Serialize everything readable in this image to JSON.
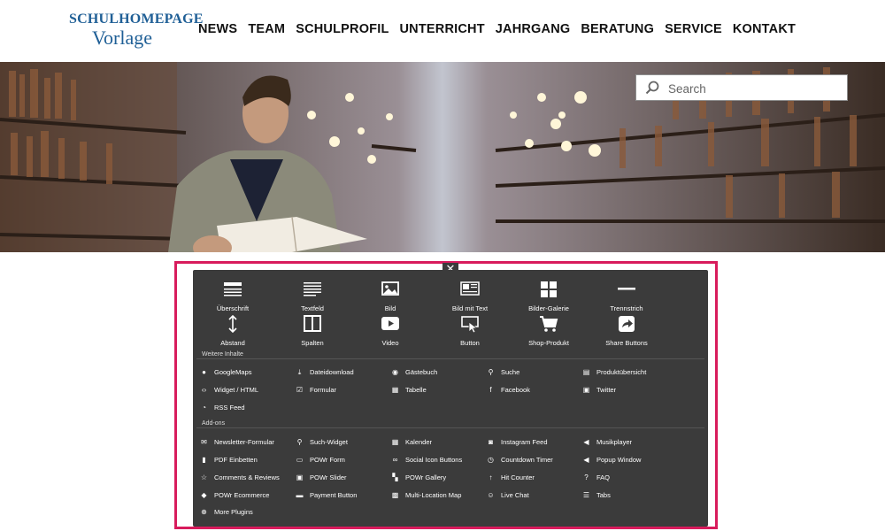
{
  "logo": {
    "line1": "SCHULHOMEPAGE",
    "line2": "Vorlage"
  },
  "nav": [
    "NEWS",
    "TEAM",
    "SCHULPROFIL",
    "UNTERRICHT",
    "JAHRGANG",
    "BERATUNG",
    "SERVICE",
    "KONTAKT"
  ],
  "search": {
    "placeholder": "Search"
  },
  "close_label": "✕",
  "basic_items": [
    {
      "label": "Überschrift",
      "icon": "heading-icon"
    },
    {
      "label": "Textfeld",
      "icon": "textfield-icon"
    },
    {
      "label": "Bild",
      "icon": "image-icon"
    },
    {
      "label": "Bild mit Text",
      "icon": "image-text-icon"
    },
    {
      "label": "Bilder-Galerie",
      "icon": "gallery-icon"
    },
    {
      "label": "Trennstrich",
      "icon": "divider-icon"
    },
    {
      "label": "Abstand",
      "icon": "spacing-icon"
    },
    {
      "label": "Spalten",
      "icon": "columns-icon"
    },
    {
      "label": "Video",
      "icon": "video-icon"
    },
    {
      "label": "Button",
      "icon": "button-icon"
    },
    {
      "label": "Shop-Produkt",
      "icon": "cart-icon"
    },
    {
      "label": "Share Buttons",
      "icon": "share-icon"
    }
  ],
  "more_title": "Weitere Inhalte",
  "more_items": [
    [
      "GoogleMaps",
      "Dateidownload",
      "Gästebuch",
      "Suche",
      "Produktübersicht"
    ],
    [
      "Widget / HTML",
      "Formular",
      "Tabelle",
      "Facebook",
      "Twitter"
    ],
    [
      "RSS Feed"
    ]
  ],
  "addons_title": "Add-ons",
  "addon_items": [
    [
      "Newsletter-Formular",
      "Such-Widget",
      "Kalender",
      "Instagram Feed",
      "Musikplayer"
    ],
    [
      "PDF Einbetten",
      "POWr Form",
      "Social Icon Buttons",
      "Countdown Timer",
      "Popup Window"
    ],
    [
      "Comments & Reviews",
      "POWr Slider",
      "POWr Gallery",
      "Hit Counter",
      "FAQ"
    ],
    [
      "POWr Ecommerce",
      "Payment Button",
      "Multi-Location Map",
      "Live Chat",
      "Tabs"
    ],
    [
      "More Plugins"
    ]
  ],
  "colors": {
    "accent": "#d81b5c",
    "panel": "#3b3b3b",
    "logo": "#1f5f96"
  }
}
